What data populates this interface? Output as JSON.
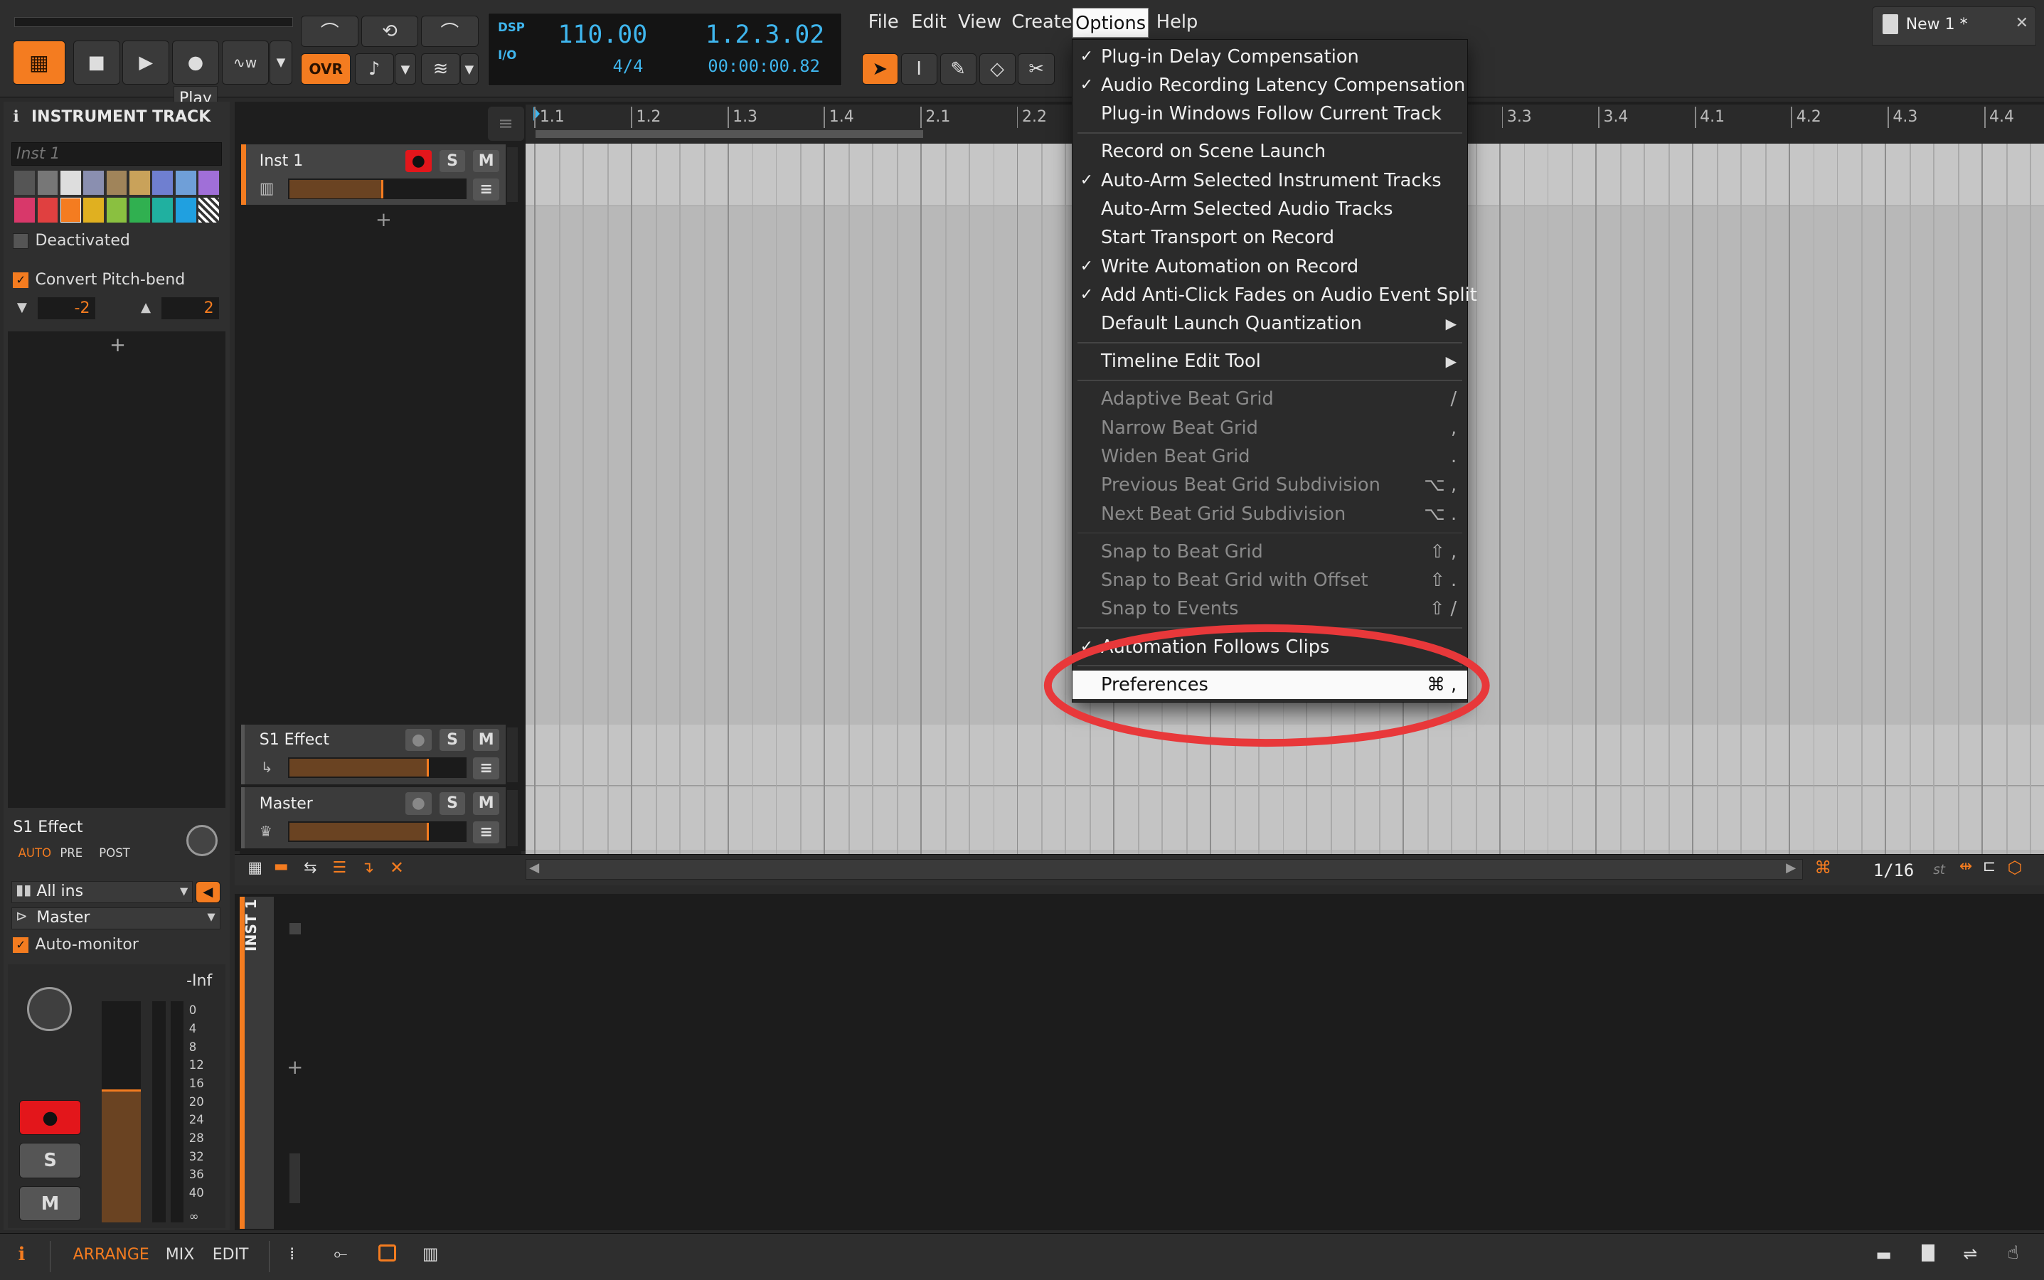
{
  "transport": {
    "tempo": "110.00",
    "signature": "4/4",
    "position_beats": "1.2.3.02",
    "position_time": "00:00:00.82",
    "dsp_label": "DSP",
    "io_label": "I/O",
    "ovr_label": "OVR",
    "play_tooltip": "Play"
  },
  "menubar": [
    "File",
    "Edit",
    "View",
    "Create",
    "Options",
    "Help"
  ],
  "document_tab": "New 1 *",
  "inspector": {
    "title": "INSTRUMENT TRACK",
    "track_name_placeholder": "Inst 1",
    "deactivated_label": "Deactivated",
    "pitchbend_label": "Convert Pitch-bend",
    "pitchbend_down": "-2",
    "pitchbend_up": "2",
    "send_name": "S1 Effect",
    "send_modes": [
      "AUTO",
      "PRE",
      "POST"
    ],
    "input": "All ins",
    "output": "Master",
    "automonitor_label": "Auto-monitor",
    "meter_peak": "-Inf",
    "meter_scale": [
      "0",
      "4",
      "8",
      "12",
      "16",
      "20",
      "24",
      "28",
      "32",
      "36",
      "40",
      "∞"
    ],
    "solo": "S",
    "mute": "M"
  },
  "tracks": [
    {
      "name": "Inst 1",
      "solo": "S",
      "mute": "M"
    },
    {
      "name": "S1 Effect",
      "solo": "S",
      "mute": "M"
    },
    {
      "name": "Master",
      "solo": "S",
      "mute": "M"
    }
  ],
  "ruler": [
    "1.1",
    "1.2",
    "1.3",
    "1.4",
    "2.1",
    "2.2",
    "3.3",
    "3.4",
    "4.1",
    "4.2",
    "4.3",
    "4.4"
  ],
  "footer": {
    "grid": "1/16",
    "grid_unit": "st",
    "device_panel_label": "INST 1",
    "views": [
      "ARRANGE",
      "MIX",
      "EDIT"
    ]
  },
  "options_menu": [
    {
      "label": "Plug-in Delay Compensation",
      "checked": true
    },
    {
      "label": "Audio Recording Latency Compensation",
      "checked": true
    },
    {
      "label": "Plug-in Windows Follow Current Track",
      "checked": false
    },
    {
      "label": "Record on Scene Launch",
      "checked": false
    },
    {
      "label": "Auto-Arm Selected Instrument Tracks",
      "checked": true
    },
    {
      "label": "Auto-Arm Selected Audio Tracks",
      "checked": false
    },
    {
      "label": "Start Transport on Record",
      "checked": false
    },
    {
      "label": "Write Automation on Record",
      "checked": true
    },
    {
      "label": "Add Anti-Click Fades on Audio Event Split",
      "checked": true
    },
    {
      "label": "Default Launch Quantization",
      "submenu": true
    },
    {
      "label": "Timeline Edit Tool",
      "submenu": true
    },
    {
      "label": "Adaptive Beat Grid",
      "shortcut": "/",
      "disabled": true
    },
    {
      "label": "Narrow Beat Grid",
      "shortcut": ",",
      "disabled": true
    },
    {
      "label": "Widen Beat Grid",
      "shortcut": ".",
      "disabled": true
    },
    {
      "label": "Previous Beat Grid Subdivision",
      "shortcut": "⌥ ,",
      "disabled": true
    },
    {
      "label": "Next Beat Grid Subdivision",
      "shortcut": "⌥ .",
      "disabled": true
    },
    {
      "label": "Snap to Beat Grid",
      "shortcut": "⇧ ,",
      "disabled": true
    },
    {
      "label": "Snap to Beat Grid with Offset",
      "shortcut": "⇧ .",
      "disabled": true
    },
    {
      "label": "Snap to Events",
      "shortcut": "⇧ /",
      "disabled": true
    },
    {
      "label": "Automation Follows Clips",
      "checked": true
    },
    {
      "label": "Preferences",
      "shortcut": "⌘ ,"
    }
  ],
  "colors": {
    "accent": "#f47c20",
    "lcd": "#3fb6ee",
    "record": "#e3161b",
    "highlight_ring": "#e8383a"
  }
}
